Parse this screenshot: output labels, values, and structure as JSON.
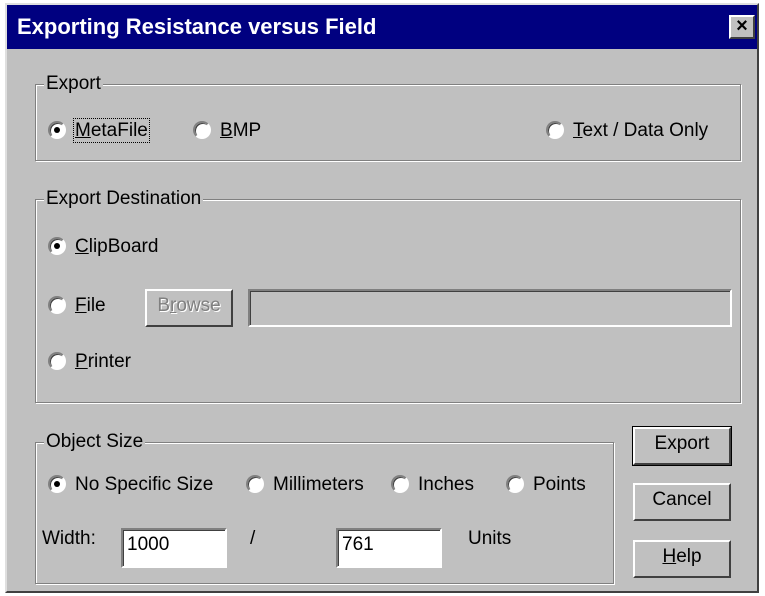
{
  "window": {
    "title": "Exporting Resistance versus Field",
    "close_glyph": "×"
  },
  "export_group": {
    "legend": "Export",
    "options": [
      {
        "label": "MetaFile",
        "accel": "M",
        "rest": "etaFile",
        "selected": true
      },
      {
        "label": "BMP",
        "accel": "B",
        "rest": "MP",
        "selected": false
      },
      {
        "label": "Text / Data Only",
        "accel": "T",
        "rest": "ext / Data Only",
        "selected": false
      }
    ]
  },
  "destination_group": {
    "legend": "Export Destination",
    "options": [
      {
        "label": "ClipBoard",
        "accel": "C",
        "rest": "lipBoard",
        "selected": true
      },
      {
        "label": "File",
        "accel": "F",
        "rest": "ile",
        "selected": false
      },
      {
        "label": "Printer",
        "accel": "P",
        "rest": "rinter",
        "selected": false
      }
    ],
    "browse": {
      "label": "Browse",
      "pre": "B",
      "accel": "r",
      "rest": "owse",
      "enabled": false
    },
    "file_path": ""
  },
  "size_group": {
    "legend": "Object Size",
    "options": [
      {
        "label": "No Specific Size",
        "selected": true
      },
      {
        "label": "Millimeters",
        "selected": false
      },
      {
        "label": "Inches",
        "selected": false
      },
      {
        "label": "Points",
        "selected": false
      }
    ],
    "width_label": "Width:",
    "width_value": "1000",
    "separator": "/",
    "height_value": "761",
    "units_label": "Units"
  },
  "buttons": {
    "export": "Export",
    "cancel": "Cancel",
    "help": {
      "label": "Help",
      "accel": "H",
      "rest": "elp"
    }
  }
}
